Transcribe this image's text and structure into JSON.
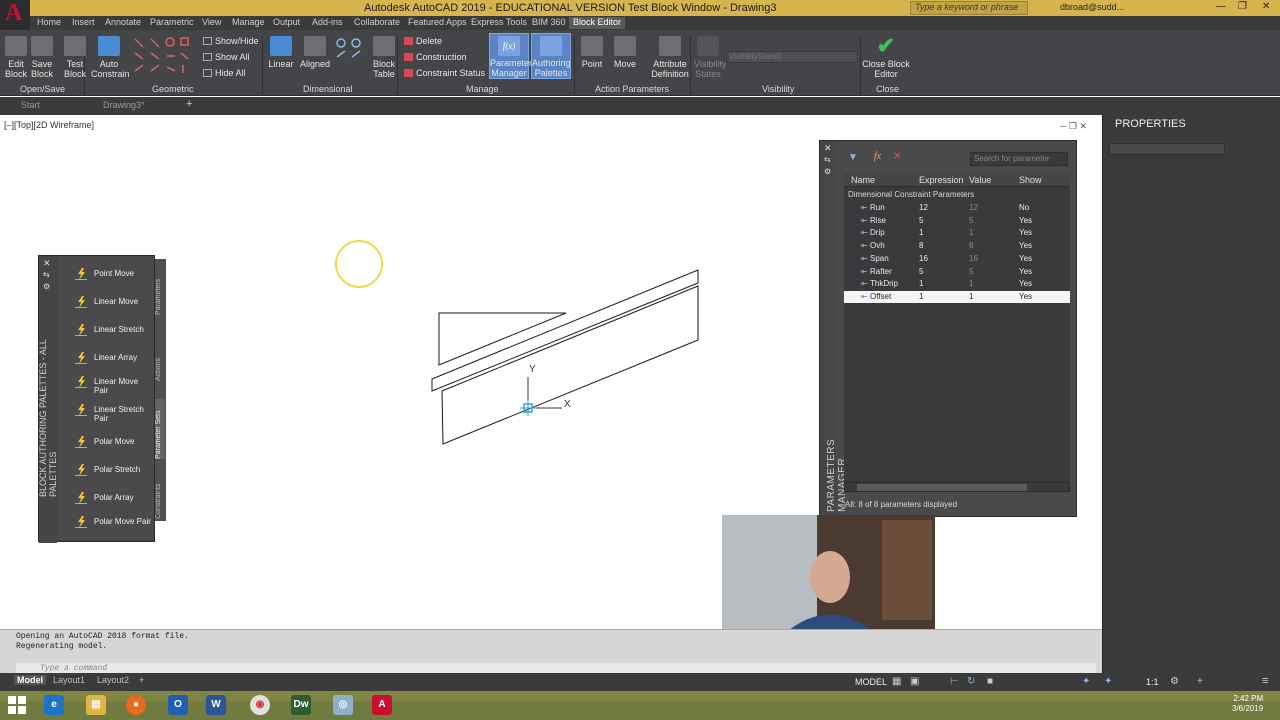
{
  "window": {
    "title": "Autodesk AutoCAD 2019 - EDUCATIONAL VERSION    Test Block Window - Drawing3",
    "search_placeholder": "Type a keyword or phrase",
    "user": "dbroad@sudd...",
    "app_letter": "A"
  },
  "ribbon_tabs": [
    "Home",
    "Insert",
    "Annotate",
    "Parametric",
    "View",
    "Manage",
    "Output",
    "Add-ins",
    "Collaborate",
    "Featured Apps",
    "Express Tools",
    "BIM 360",
    "Block Editor"
  ],
  "ribbon": {
    "open_save": {
      "edit_block": "Edit Block",
      "save_block": "Save Block",
      "panel": "Open/Save"
    },
    "geometric": {
      "test_block": "Test Block",
      "auto_constrain": "Auto Constrain",
      "show_hide": "Show/Hide",
      "show_all": "Show All",
      "hide_all": "Hide All",
      "panel": "Geometric"
    },
    "dimensional": {
      "linear": "Linear",
      "aligned": "Aligned",
      "panel": "Dimensional"
    },
    "manage": {
      "block_table": "Block Table",
      "delete": "Delete",
      "construction": "Construction",
      "constraint_status": "Constraint Status",
      "parameters_manager": "Parameters Manager",
      "authoring_palettes": "Authoring Palettes",
      "panel": "Manage"
    },
    "action_params": {
      "point": "Point",
      "move": "Move",
      "attribute_definition": "Attribute Definition",
      "panel": "Action Parameters"
    },
    "visibility": {
      "visibility_states": "Visibility States",
      "visibility_state_value": "VisibilityState0",
      "panel": "Visibility"
    },
    "close": {
      "close_block_editor": "Close Block Editor",
      "panel": "Close"
    }
  },
  "file_tabs": [
    "Start",
    "Drawing3*"
  ],
  "viewport_label": "[–][Top][2D Wireframe]",
  "properties": {
    "title": "PROPERTIES"
  },
  "parameters_manager": {
    "side_title": "PARAMETERS MANAGER",
    "search_placeholder": "Search for parameter",
    "columns": [
      "Name",
      "Expression",
      "Value",
      "Show"
    ],
    "group": "Dimensional Constraint Parameters",
    "rows": [
      {
        "name": "Run",
        "expr": "12",
        "value": "12",
        "show": "No"
      },
      {
        "name": "Rise",
        "expr": "5",
        "value": "5",
        "show": "Yes"
      },
      {
        "name": "Drip",
        "expr": "1",
        "value": "1",
        "show": "Yes"
      },
      {
        "name": "Ovh",
        "expr": "8",
        "value": "8",
        "show": "Yes"
      },
      {
        "name": "Span",
        "expr": "16",
        "value": "16",
        "show": "Yes"
      },
      {
        "name": "Rafter",
        "expr": "5",
        "value": "5",
        "show": "Yes"
      },
      {
        "name": "ThkDrip",
        "expr": "1",
        "value": "1",
        "show": "Yes"
      },
      {
        "name": "Offset",
        "expr": "1",
        "value": "1",
        "show": "Yes"
      }
    ],
    "status": "All: 8 of 8 parameters displayed"
  },
  "palette": {
    "title": "BLOCK AUTHORING PALETTES - ALL PALETTES",
    "tabs": [
      "Parameters",
      "Actions",
      "Parameter Sets",
      "Constraints"
    ],
    "items": [
      {
        "label": "Point Move"
      },
      {
        "label": "Linear Move"
      },
      {
        "label": "Linear Stretch"
      },
      {
        "label": "Linear Array"
      },
      {
        "label": "Linear Move Pair"
      },
      {
        "label": "Linear Stretch Pair"
      },
      {
        "label": "Polar Move"
      },
      {
        "label": "Polar Stretch"
      },
      {
        "label": "Polar Array"
      },
      {
        "label": "Polar Move Pair"
      }
    ]
  },
  "ucs": {
    "y": "Y",
    "x": "X"
  },
  "command": {
    "history": [
      "Opening an AutoCAD 2018 format file.",
      "Regenerating model."
    ],
    "placeholder": "Type a command"
  },
  "layout_tabs": [
    "Model",
    "Layout1",
    "Layout2"
  ],
  "status": {
    "model": "MODEL",
    "scale": "1:1"
  },
  "clock": {
    "time": "2:42 PM",
    "date": "3/6/2019"
  },
  "taskbar": [
    "start-icon",
    "edge-icon",
    "explorer-icon",
    "firefox-icon",
    "outlook-icon",
    "word-icon",
    "chrome-icon",
    "dreamweaver-icon",
    "network-icon",
    "autocad-icon"
  ],
  "colors": {
    "title_bar": "#d6b44e",
    "ribbon": "#444548",
    "accent_blue": "#4a8bd6",
    "autocad_red": "#c8102e"
  }
}
